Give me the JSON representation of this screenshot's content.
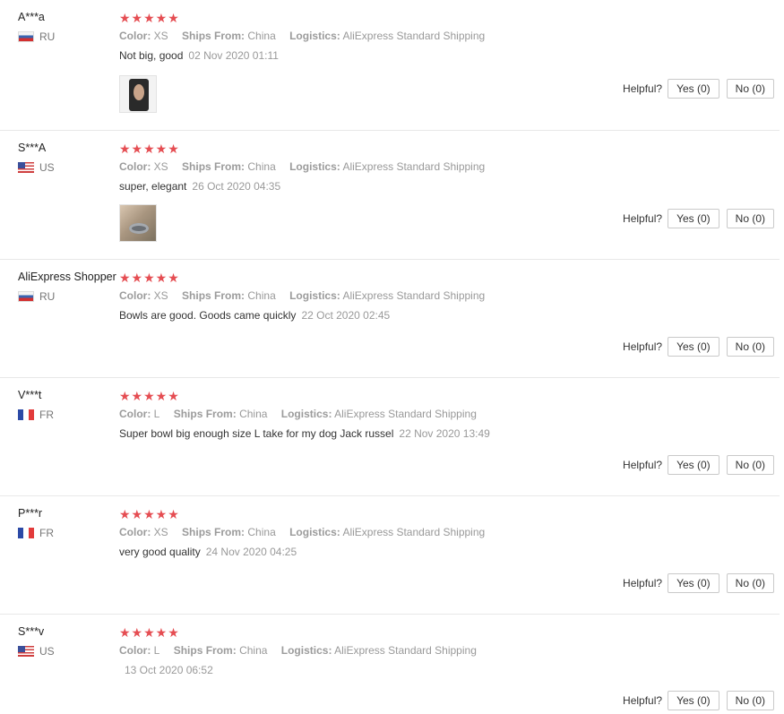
{
  "labels": {
    "color": "Color:",
    "ships_from": "Ships From:",
    "logistics": "Logistics:",
    "helpful": "Helpful?"
  },
  "rating_stars": "★★★★★",
  "reviews": [
    {
      "name": "A***a",
      "country": "RU",
      "flag": "ru-flag",
      "rating": 5,
      "color": "XS",
      "ships_from": "China",
      "logistics": "AliExpress Standard Shipping",
      "text": "Not big, good",
      "date": "02 Nov 2020 01:11",
      "yes": "Yes (0)",
      "no": "No (0)"
    },
    {
      "name": "S***A",
      "country": "US",
      "flag": "us-flag",
      "rating": 5,
      "color": "XS",
      "ships_from": "China",
      "logistics": "AliExpress Standard Shipping",
      "text": "super, elegant",
      "date": "26 Oct 2020 04:35",
      "yes": "Yes (0)",
      "no": "No (0)"
    },
    {
      "name": "AliExpress Shopper",
      "country": "RU",
      "flag": "ru-flag",
      "rating": 5,
      "color": "XS",
      "ships_from": "China",
      "logistics": "AliExpress Standard Shipping",
      "text": "Bowls are good. Goods came quickly",
      "date": "22 Oct 2020 02:45",
      "yes": "Yes (0)",
      "no": "No (0)"
    },
    {
      "name": "V***t",
      "country": "FR",
      "flag": "fr-flag",
      "rating": 5,
      "color": "L",
      "ships_from": "China",
      "logistics": "AliExpress Standard Shipping",
      "text": "Super bowl big enough size L take for my dog Jack russel",
      "date": "22 Nov 2020 13:49",
      "yes": "Yes (0)",
      "no": "No (0)"
    },
    {
      "name": "P***r",
      "country": "FR",
      "flag": "fr-flag",
      "rating": 5,
      "color": "XS",
      "ships_from": "China",
      "logistics": "AliExpress Standard Shipping",
      "text": "very good quality",
      "date": "24 Nov 2020 04:25",
      "yes": "Yes (0)",
      "no": "No (0)"
    },
    {
      "name": "S***v",
      "country": "US",
      "flag": "us-flag",
      "rating": 5,
      "color": "L",
      "ships_from": "China",
      "logistics": "AliExpress Standard Shipping",
      "text": "",
      "date": "13 Oct 2020 06:52",
      "yes": "Yes (0)",
      "no": "No (0)"
    }
  ]
}
